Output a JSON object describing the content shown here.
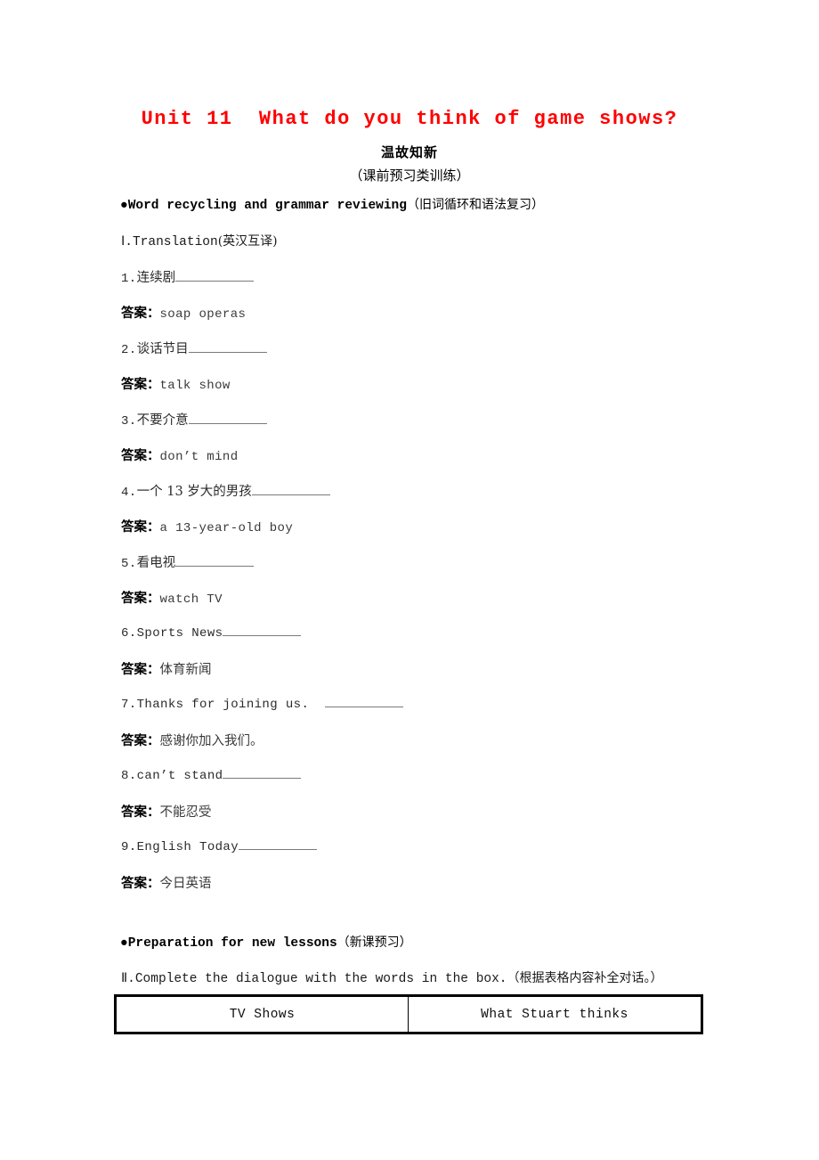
{
  "title": "Unit 11  What do you think of game shows?",
  "headings": {
    "main": "温故知新",
    "sub": "（课前预习类训练）"
  },
  "sections": [
    {
      "bullet": "●",
      "en": "Word recycling and grammar reviewing",
      "cn": "（旧词循环和语法复习）"
    },
    {
      "bullet": "●",
      "en": "Preparation for new lessons",
      "cn": "（新课预习）"
    }
  ],
  "part1": {
    "label": "Ⅰ.Translation",
    "cn": "(英汉互译)"
  },
  "part2": {
    "label": "Ⅱ.Complete the dialogue with the words in the box.",
    "cn": "（根据表格内容补全对话。）"
  },
  "answer_label": "答案：",
  "items": [
    {
      "num": "1.",
      "prompt": "连续剧",
      "prompt_mono": false,
      "blank_w": 88,
      "answer": "soap operas",
      "answer_mono": true
    },
    {
      "num": "2.",
      "prompt": "谈话节目",
      "prompt_mono": false,
      "blank_w": 88,
      "answer": "talk show",
      "answer_mono": true
    },
    {
      "num": "3.",
      "prompt": "不要介意",
      "prompt_mono": false,
      "blank_w": 88,
      "answer": "don’t mind",
      "answer_mono": true
    },
    {
      "num": "4.",
      "prompt": "一个 13 岁大的男孩",
      "prompt_mono": false,
      "blank_w": 88,
      "answer": "a 13-year-old boy",
      "answer_mono": true
    },
    {
      "num": "5.",
      "prompt": "看电视",
      "prompt_mono": false,
      "blank_w": 88,
      "answer": "watch TV",
      "answer_mono": true
    },
    {
      "num": "6.",
      "prompt": "Sports News",
      "prompt_mono": true,
      "blank_w": 88,
      "answer": "体育新闻",
      "answer_mono": false
    },
    {
      "num": "7.",
      "prompt": "Thanks for joining us.  ",
      "prompt_mono": true,
      "blank_w": 88,
      "answer": "感谢你加入我们。",
      "answer_mono": false
    },
    {
      "num": "8.",
      "prompt": "can’t stand",
      "prompt_mono": true,
      "blank_w": 88,
      "answer": "不能忍受",
      "answer_mono": false
    },
    {
      "num": "9.",
      "prompt": "English Today",
      "prompt_mono": true,
      "blank_w": 88,
      "answer": "今日英语",
      "answer_mono": false
    }
  ],
  "table": {
    "headers": [
      "TV Shows",
      "What Stuart thinks"
    ]
  },
  "colors": {
    "title": "#ff0000",
    "text": "#000000",
    "answer_text": "#3a3a3a",
    "rule": "#7a7a7a",
    "table_border": "#000000"
  }
}
